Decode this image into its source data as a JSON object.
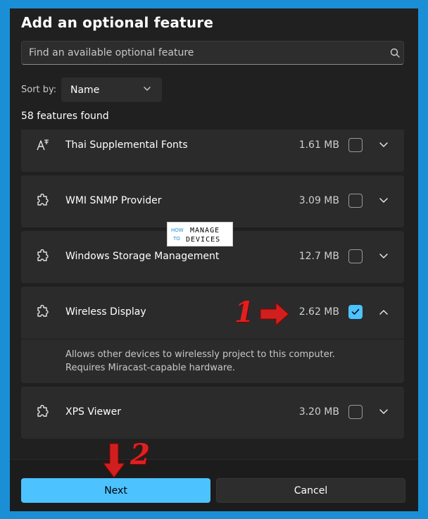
{
  "dialog": {
    "title": "Add an optional feature",
    "search_placeholder": "Find an available optional feature",
    "sort_label": "Sort by:",
    "sort_value": "Name",
    "count_text": "58 features found"
  },
  "features": [
    {
      "name": "Thai Supplemental Fonts",
      "size": "1.61 MB",
      "checked": false,
      "expanded": false,
      "icon": "font-icon"
    },
    {
      "name": "WMI SNMP Provider",
      "size": "3.09 MB",
      "checked": false,
      "expanded": false,
      "icon": "puzzle-icon"
    },
    {
      "name": "Windows Storage Management",
      "size": "12.7 MB",
      "checked": false,
      "expanded": false,
      "icon": "puzzle-icon"
    },
    {
      "name": "Wireless Display",
      "size": "2.62 MB",
      "checked": true,
      "expanded": true,
      "icon": "puzzle-icon",
      "description_line1": "Allows other devices to wirelessly project to this computer.",
      "description_line2": "Requires Miracast-capable hardware."
    },
    {
      "name": "XPS Viewer",
      "size": "3.20 MB",
      "checked": false,
      "expanded": false,
      "icon": "puzzle-icon"
    }
  ],
  "buttons": {
    "next": "Next",
    "cancel": "Cancel"
  },
  "annotations": {
    "step1": "1",
    "step2": "2"
  },
  "watermark": {
    "line1a": "HOW",
    "line1b": "TO",
    "line2": "MANAGE",
    "line3": "DEVICES"
  },
  "colors": {
    "accent": "#4cc2ff",
    "background": "#202020",
    "frame": "#1a8fd6",
    "annotation_red": "#e02020"
  }
}
